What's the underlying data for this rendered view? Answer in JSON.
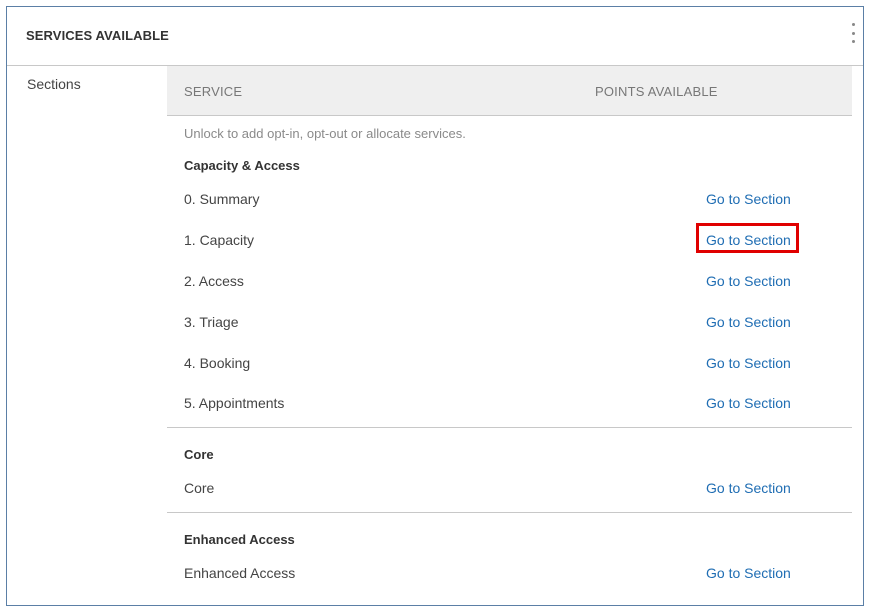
{
  "panel": {
    "title": "SERVICES AVAILABLE",
    "menu_icon": "more-vertical-icon",
    "sidebar_label": "Sections"
  },
  "table": {
    "headers": {
      "service": "SERVICE",
      "points": "POINTS AVAILABLE"
    },
    "hint": "Unlock to add opt-in, opt-out or allocate services."
  },
  "groups": [
    {
      "title": "Capacity & Access",
      "rows": [
        {
          "label": "0. Summary",
          "link": "Go to Section"
        },
        {
          "label": "1. Capacity",
          "link": "Go to Section"
        },
        {
          "label": "2. Access",
          "link": "Go to Section"
        },
        {
          "label": "3. Triage",
          "link": "Go to Section"
        },
        {
          "label": "4. Booking",
          "link": "Go to Section"
        },
        {
          "label": "5. Appointments",
          "link": "Go to Section"
        }
      ]
    },
    {
      "title": "Core",
      "rows": [
        {
          "label": "Core",
          "link": "Go to Section"
        }
      ]
    },
    {
      "title": "Enhanced Access",
      "rows": [
        {
          "label": "Enhanced Access",
          "link": "Go to Section"
        }
      ]
    }
  ],
  "colors": {
    "link": "#1f6db3",
    "highlight": "#e00000",
    "panel_border": "#5b7fa6"
  }
}
